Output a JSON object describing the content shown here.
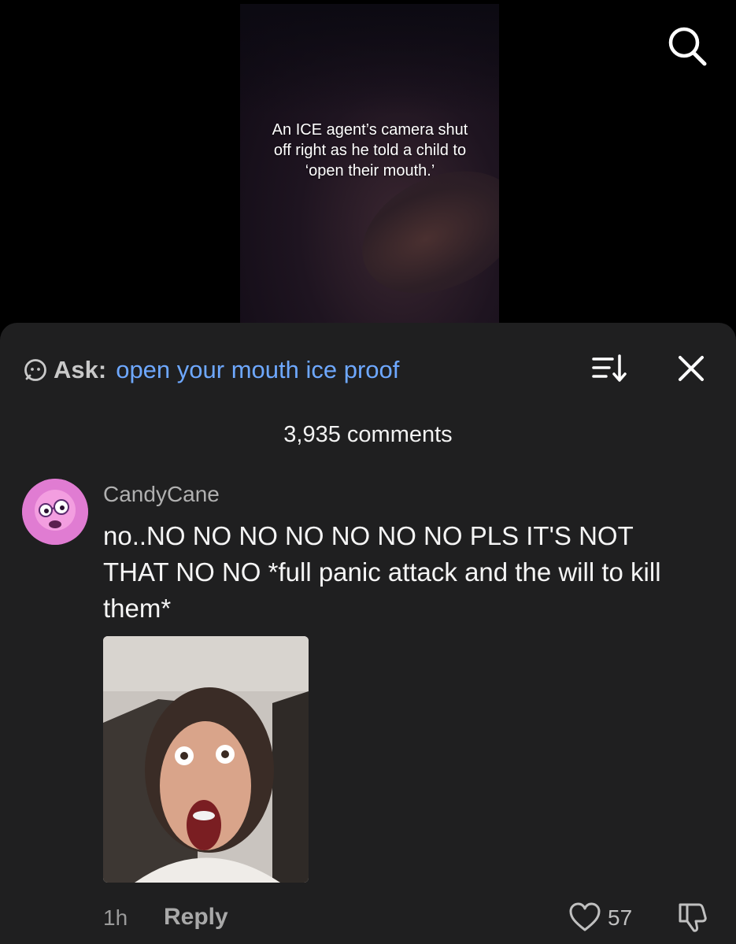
{
  "video": {
    "caption": "An ICE agent’s camera shut off right as he told a child to ‘open their mouth.’"
  },
  "header": {
    "search_icon": "search-icon"
  },
  "ask": {
    "label": "Ask:",
    "query": "open your mouth ice proof"
  },
  "comments": {
    "count_label": "3,935 comments",
    "items": [
      {
        "username": "CandyCane",
        "text": "no..NO NO NO NO NO NO NO PLS IT'S NOT THAT NO NO *full panic attack and the will to kill them*",
        "time": "1h",
        "reply_label": "Reply",
        "likes": "57"
      }
    ]
  },
  "colors": {
    "sheet_bg": "#1f1f20",
    "link_blue": "#6ea8ff"
  }
}
